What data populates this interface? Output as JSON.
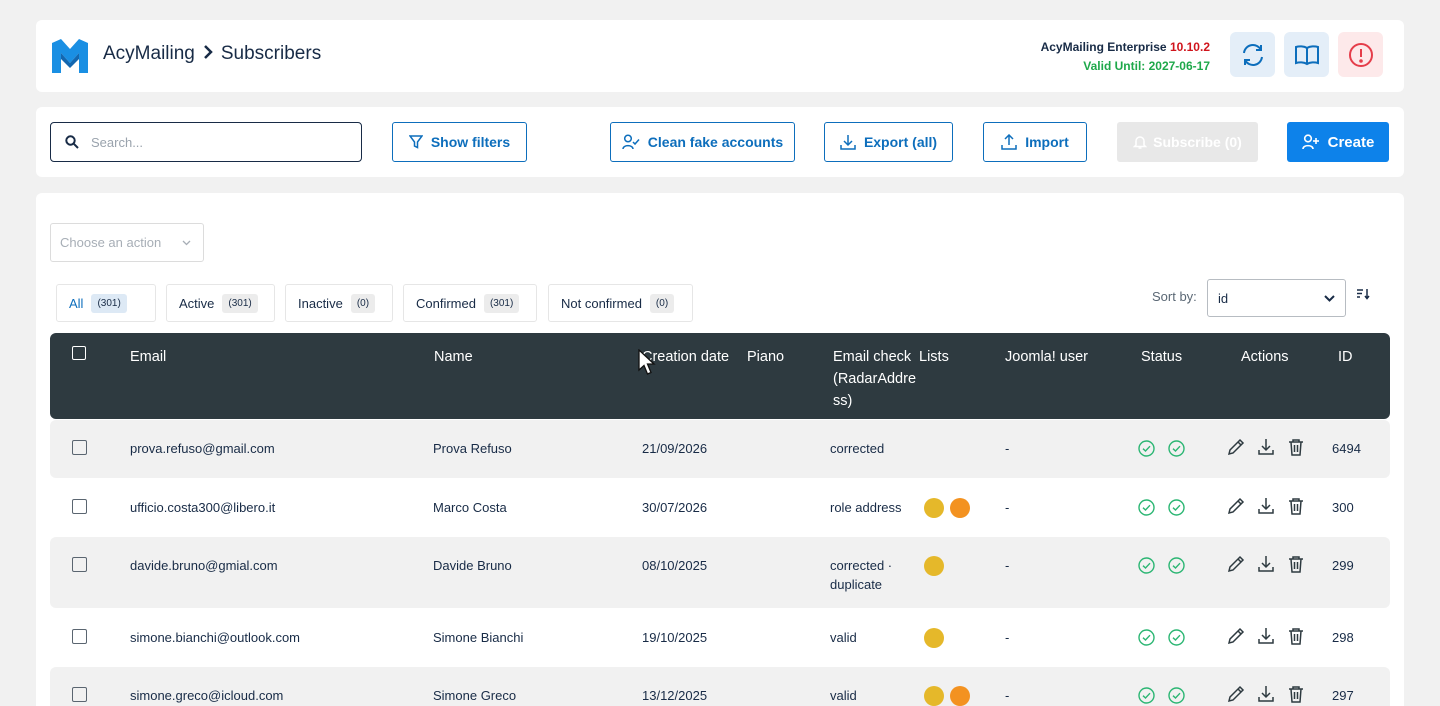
{
  "header": {
    "breadcrumb_app": "AcyMailing",
    "breadcrumb_page": "Subscribers",
    "edition": "AcyMailing Enterprise",
    "version": "10.10.2",
    "valid_until": "Valid Until: 2027-06-17",
    "colors": {
      "brand": "#1a8fe3",
      "version": "#d0141c",
      "valid": "#1ea84a"
    }
  },
  "toolbar": {
    "search_placeholder": "Search...",
    "show_filters": "Show filters",
    "clean_fake": "Clean fake accounts",
    "export": "Export (all)",
    "import": "Import",
    "subscribe": "Subscribe (0)",
    "create": "Create",
    "colors": {
      "primary": "#0d82ea"
    }
  },
  "main": {
    "action_placeholder": "Choose an action",
    "status_tabs": [
      {
        "label": "All",
        "count": "(301)"
      },
      {
        "label": "Active",
        "count": "(301)"
      },
      {
        "label": "Inactive",
        "count": "(0)"
      },
      {
        "label": "Confirmed",
        "count": "(301)"
      },
      {
        "label": "Not confirmed",
        "count": "(0)"
      }
    ],
    "sort_label": "Sort by:",
    "sort_value": "id"
  },
  "table": {
    "columns": {
      "email": "Email",
      "name": "Name",
      "creation_date": "Creation date",
      "piano": "Piano",
      "email_check_1": "Email check",
      "email_check_2": "(RadarAddre",
      "email_check_3": "ss)",
      "lists": "Lists",
      "joomla_user": "Joomla! user",
      "status": "Status",
      "actions": "Actions",
      "id": "ID"
    },
    "rows": [
      {
        "email": "prova.refuso@gmail.com",
        "name": "Prova Refuso",
        "date": "21/09/2026",
        "check": "corrected",
        "check2": "",
        "lists": [],
        "joomla": "-",
        "id": "6494"
      },
      {
        "email": "ufficio.costa300@libero.it",
        "name": "Marco Costa",
        "date": "30/07/2026",
        "check": "role address",
        "check2": "",
        "lists": [
          "#e5b82a",
          "#f39220"
        ],
        "joomla": "-",
        "id": "300"
      },
      {
        "email": "davide.bruno@gmial.com",
        "name": "Davide Bruno",
        "date": "08/10/2025",
        "check": "corrected ·",
        "check2": "duplicate",
        "lists": [
          "#e5b82a"
        ],
        "joomla": "-",
        "id": "299"
      },
      {
        "email": "simone.bianchi@outlook.com",
        "name": "Simone Bianchi",
        "date": "19/10/2025",
        "check": "valid",
        "check2": "",
        "lists": [
          "#e5b82a"
        ],
        "joomla": "-",
        "id": "298"
      },
      {
        "email": "simone.greco@icloud.com",
        "name": "Simone Greco",
        "date": "13/12/2025",
        "check": "valid",
        "check2": "",
        "lists": [
          "#e5b82a",
          "#f39220"
        ],
        "joomla": "-",
        "id": "297"
      }
    ],
    "status_color": "#2bb673"
  }
}
